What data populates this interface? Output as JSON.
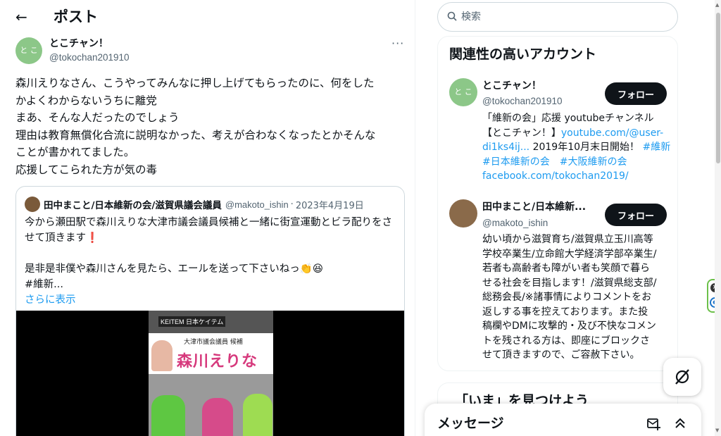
{
  "header": {
    "back_icon": "arrow-left-icon",
    "title": "ポスト"
  },
  "tweet": {
    "avatar_text": "と こ",
    "author_name": "とこチャン！",
    "author_handle": "@tokochan201910",
    "more_label": "···",
    "text_lines": [
      "森川えりなさん、こうやってみんなに押し上げてもらったのに、何をした",
      "かよくわからないうちに離党",
      "まあ、そんな人だったのでしょう",
      "理由は教育無償化合流に説明なかった、考えが合わなくなったとかそんな",
      "ことが書かれてました。",
      "応援してこられた方が気の毒"
    ]
  },
  "quote": {
    "author_name": "田中まこと/日本維新の会/滋賀県議会議員",
    "author_handle": "@makoto_ishin",
    "separator": "·",
    "date": "2023年4月19日",
    "line1": "今から瀬田駅で森川えりな大津市議会議員候補と一緒に街宣運動とビラ配りをさ",
    "line2": "せて頂きます",
    "line2_mark": "❗",
    "line4": "是非是非僕や森川さんを見たら、エールを送って下さいねっ👏😆",
    "line5": "#維新...",
    "show_more": "さらに表示",
    "poster": {
      "store_sign": "KEITEM 日本ケイテム",
      "banner_small": "大津市議会議員 候補",
      "banner_big": "森川えりな"
    }
  },
  "search": {
    "placeholder": "検索",
    "icon": "search-icon"
  },
  "relevant": {
    "title": "関連性の高いアカウント",
    "accounts": [
      {
        "avatar_text": "と こ",
        "name": "とこチャン！",
        "handle": "@tokochan201910",
        "follow_label": "フォロー",
        "bio_l1": "「維新の会」応援 youtubeチャンネル",
        "bio_l2a": "【とこチャン！】",
        "bio_l2b": "youtube.com/@user-",
        "bio_l3a": "di1ks4ij...",
        "bio_l3b": " 2019年10月末日開始！ ",
        "bio_l3c": "#維新",
        "bio_l4": "#日本維新の会　#大阪維新の会",
        "bio_l5": "facebook.com/tokochan2019/"
      },
      {
        "name": "田中まこと/日本維新...",
        "handle": "@makoto_ishin",
        "follow_label": "フォロー",
        "bio_lines": [
          "幼い頃から滋賀育ち/滋賀県立玉川高等",
          "学校卒業生/立命館大学経済学部卒業生/",
          "若者も高齢者も障がい者も笑顔で暮ら",
          "せる社会を目指します！/滋賀県総支部/",
          "総務会長/※諸事情によりコメントをお",
          "返しする事を控えております。また投",
          "稿欄やDMに攻撃的・及び不快なコメン",
          "トを残される方は、即座にブロックさ",
          "せて頂きますので、ご容赦下さい。"
        ]
      }
    ]
  },
  "explore": {
    "title": "「いま」を見つけよう"
  },
  "messages": {
    "title": "メッセージ",
    "compose_icon": "new-message-icon",
    "expand_icon": "chevron-up-icon"
  },
  "floating_button": {
    "icon": "grok-slash-icon"
  },
  "extension": {
    "close_icon": "close-icon",
    "logo_letter": "e"
  }
}
